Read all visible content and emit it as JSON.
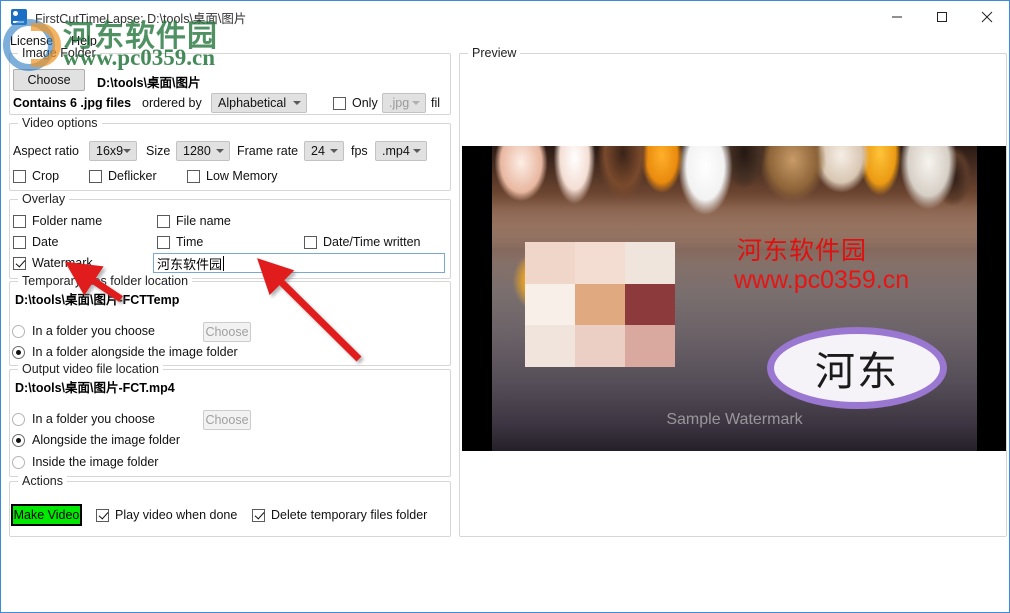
{
  "window": {
    "title": "FirstCutTimeLapse: D:\\tools\\桌面\\图片",
    "icon": "app-icon",
    "controls": {
      "minimize": "minimize-icon",
      "maximize": "maximize-icon",
      "close": "close-icon"
    }
  },
  "menu": {
    "items": [
      "License",
      "Help"
    ]
  },
  "site_watermark": {
    "cn": "河东软件园",
    "url": "www.pc0359.cn"
  },
  "image_folder": {
    "group_title": "Image Folder",
    "choose_label": "Choose",
    "path": "D:\\tools\\桌面\\图片",
    "contains_text": "Contains 6 .jpg files",
    "ordered_by_label": "ordered by",
    "order_value": "Alphabetical",
    "only_label": "Only",
    "ext_value": ".jpg",
    "only_suffix": "fil",
    "only_checked": false
  },
  "video_options": {
    "group_title": "Video options",
    "aspect_label": "Aspect ratio",
    "aspect_value": "16x9",
    "size_label": "Size",
    "size_value": "1280",
    "frame_rate_label": "Frame rate",
    "frame_rate_value": "24",
    "fps_label": "fps",
    "format_value": ".mp4",
    "checks": [
      {
        "label": "Crop",
        "checked": false
      },
      {
        "label": "Deflicker",
        "checked": false
      },
      {
        "label": "Low Memory",
        "checked": false
      }
    ]
  },
  "overlay": {
    "group_title": "Overlay",
    "checks": [
      {
        "label": "Folder name",
        "checked": false
      },
      {
        "label": "File name",
        "checked": false
      },
      {
        "label": "Date",
        "checked": false
      },
      {
        "label": "Time",
        "checked": false
      },
      {
        "label": "Date/Time written",
        "checked": false
      },
      {
        "label": "Watermark",
        "checked": true
      }
    ],
    "watermark_text": "河东软件园"
  },
  "temp_location": {
    "group_title": "Temporary files folder location",
    "path": "D:\\tools\\桌面\\图片-FCTTemp",
    "choose_label": "Choose",
    "choose_disabled": true,
    "options": [
      {
        "label": "In a folder you choose",
        "selected": false
      },
      {
        "label": "In a folder alongside the image folder",
        "selected": true
      }
    ]
  },
  "output_location": {
    "group_title": "Output video file location",
    "path": "D:\\tools\\桌面\\图片-FCT.mp4",
    "choose_label": "Choose",
    "choose_disabled": true,
    "options": [
      {
        "label": "In a folder you choose",
        "selected": false
      },
      {
        "label": "Alongside the image folder",
        "selected": true
      },
      {
        "label": "Inside the image folder",
        "selected": false
      }
    ]
  },
  "actions": {
    "group_title": "Actions",
    "make_video_label": "Make Video",
    "make_video_color": "#00e800",
    "checks": [
      {
        "label": "Play video when done",
        "checked": true
      },
      {
        "label": "Delete temporary files folder",
        "checked": true
      }
    ]
  },
  "preview": {
    "group_title": "Preview",
    "sample_watermark": "Sample Watermark",
    "image_red_cn": "河东软件园",
    "image_red_url": "www.pc0359.cn",
    "image_blob_cn": "河东",
    "mosaic_colors": [
      "#efd6c8",
      "#f3ddd2",
      "#efe5dd",
      "#f7efe8",
      "#e0a97f",
      "#8c3a3c",
      "#f0e4dc",
      "#eccfc4",
      "#d9a89e"
    ]
  },
  "annotations": {
    "arrow_color": "#e01b1b",
    "count": 2
  }
}
